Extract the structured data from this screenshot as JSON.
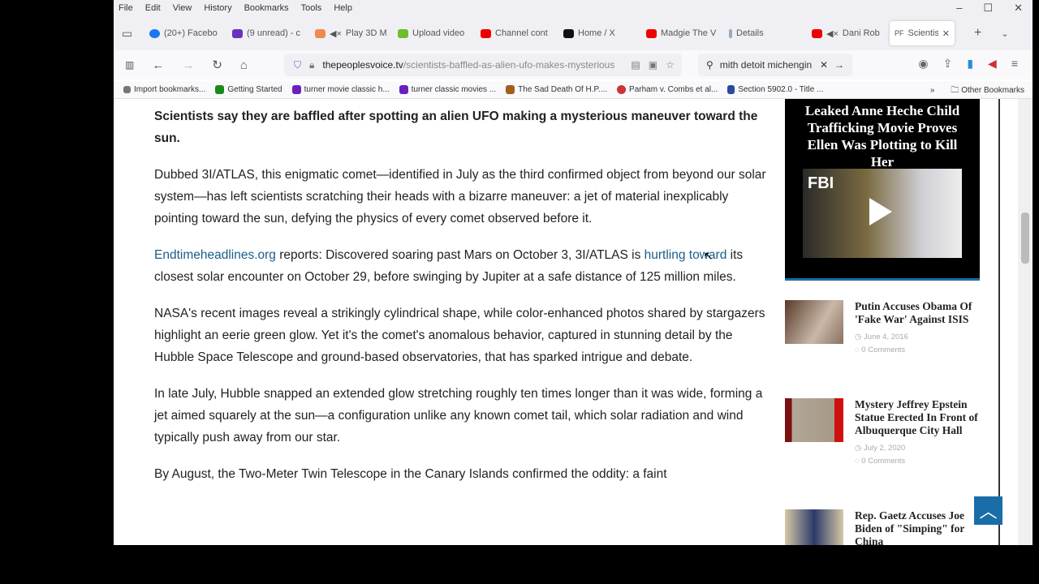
{
  "menu": [
    "File",
    "Edit",
    "View",
    "History",
    "Bookmarks",
    "Tools",
    "Help"
  ],
  "tabs": [
    {
      "label": "(20+) Facebo",
      "color": "#1877f2"
    },
    {
      "label": "(9 unread) - c",
      "color": "#6b2fbf"
    },
    {
      "label": "Play 3D M",
      "color": "#f08a50"
    },
    {
      "label": "Upload video",
      "color": "#6abf2a"
    },
    {
      "label": "Channel cont",
      "color": "#e00"
    },
    {
      "label": "Home / X",
      "color": "#111"
    },
    {
      "label": "Madgie The V",
      "color": "#e00"
    },
    {
      "label": "Details",
      "color": "#9ab"
    },
    {
      "label": "Dani Rob",
      "color": "#e00"
    },
    {
      "label": "Scientists B",
      "color": "#555"
    }
  ],
  "url": {
    "host": "thepeoplesvoice.tv",
    "path": "/scientists-baffled-as-alien-ufo-makes-mysterious"
  },
  "search": {
    "value": "mith detoit michengin"
  },
  "bookmarks": [
    {
      "label": "Import bookmarks...",
      "color": "#777"
    },
    {
      "label": "Getting Started",
      "color": "#1a8a1a"
    },
    {
      "label": "turner movie classic h...",
      "color": "#6b1fbf"
    },
    {
      "label": "turner classic movies ...",
      "color": "#6b1fbf"
    },
    {
      "label": "The Sad Death Of H.P....",
      "color": "#a0601a"
    },
    {
      "label": "Parham v. Combs et al...",
      "color": "#c33"
    },
    {
      "label": "Section 5902.0 - Title ...",
      "color": "#2a4aa0"
    }
  ],
  "other_bookmarks": "Other Bookmarks",
  "article": {
    "lead": "Scientists say they are baffled after spotting an alien UFO making a mysterious maneuver toward the sun.",
    "p1": "Dubbed 3I/ATLAS, this enigmatic comet—identified in July as the third confirmed object from beyond our solar system—has left scientists scratching their heads with a bizarre maneuver: a jet of material inexplicably pointing toward the sun, defying the physics of every comet observed before it.",
    "p2_link1": "Endtimeheadlines.org",
    "p2_mid": " reports: Discovered soaring past Mars on October 3, 3I/ATLAS is ",
    "p2_link2": "hurtling toward",
    "p2_end": " its closest solar encounter on October 29, before swinging by Jupiter at a safe distance of 125 million miles.",
    "p3": "NASA's recent images reveal a strikingly cylindrical shape, while color-enhanced photos shared by stargazers highlight an eerie green glow. Yet it's the comet's anomalous behavior, captured in stunning detail by the Hubble Space Telescope and ground-based observatories, that has sparked intrigue and debate.",
    "p4": "In late July, Hubble snapped an extended glow stretching roughly ten times longer than it was wide, forming a jet aimed squarely at the sun—a configuration unlike any known comet tail, which solar radiation and wind typically push away from our star.",
    "p5": "By August, the Two-Meter Twin Telescope in the Canary Islands confirmed the oddity: a faint"
  },
  "promo": {
    "title": "Leaked Anne Heche Child Trafficking Movie Proves Ellen Was Plotting to Kill Her",
    "badge": "FBI"
  },
  "related": [
    {
      "title": "Putin Accuses Obama Of 'Fake War' Against ISIS",
      "date": "June 4, 2016",
      "comments": "0 Comments"
    },
    {
      "title": "Mystery Jeffrey Epstein Statue Erected In Front of Albuquerque City Hall",
      "date": "July 2, 2020",
      "comments": "0 Comments"
    },
    {
      "title": "Rep. Gaetz Accuses Joe Biden of \"Simping\" for China"
    }
  ]
}
